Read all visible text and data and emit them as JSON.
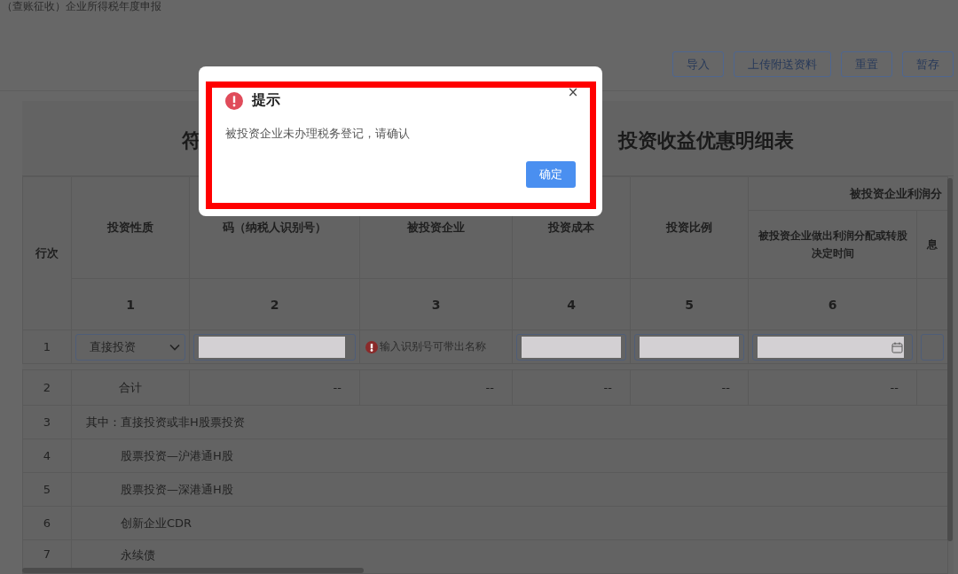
{
  "page_title": "（查账征收）企业所得税年度申报",
  "toolbar": {
    "buttons": [
      "导入",
      "上传附送资料",
      "重置",
      "暂存"
    ]
  },
  "form_title": {
    "left": "符",
    "right": "投资收益优惠明细表"
  },
  "table": {
    "columns": [
      {
        "label": "行次"
      },
      {
        "label": "投资性质",
        "number": "1"
      },
      {
        "label": "码（纳税人识别号）",
        "number": "2"
      },
      {
        "label": "被投资企业",
        "number": "3"
      },
      {
        "label": "投资成本",
        "number": "4"
      },
      {
        "label": "投资比例",
        "number": "5"
      }
    ],
    "column_group": {
      "label": "被投资企业利润分",
      "columns": [
        {
          "label": "被投资企业做出利润分配或转股决定时间",
          "number": "6"
        },
        {
          "label": "息"
        }
      ]
    },
    "rows": [
      {
        "row": "1",
        "kind": "input",
        "cells": [
          {
            "kind": "select",
            "value": "直接投资"
          },
          {
            "kind": "masked"
          },
          {
            "kind": "lookup",
            "placeholder": "输入识别号可带出名称"
          },
          {
            "kind": "masked"
          },
          {
            "kind": "masked"
          },
          {
            "kind": "masked-date"
          },
          {
            "kind": "input"
          }
        ]
      },
      {
        "row": "2",
        "kind": "total",
        "label": "合计",
        "values": [
          "--",
          "--",
          "--",
          "--",
          "--"
        ]
      },
      {
        "row": "3",
        "kind": "label",
        "prefix": "其中：",
        "label": "直接投资或非H股票投资"
      },
      {
        "row": "4",
        "kind": "label",
        "label": "股票投资—沪港通H股"
      },
      {
        "row": "5",
        "kind": "label",
        "label": "股票投资—深港通H股"
      },
      {
        "row": "6",
        "kind": "label",
        "label": "创新企业CDR"
      },
      {
        "row": "7",
        "kind": "label",
        "label": "永续债"
      }
    ]
  },
  "dialog": {
    "title": "提示",
    "message": "被投资企业未办理税务登记，请确认",
    "close": "×",
    "button": "确定",
    "highlighted": true
  }
}
